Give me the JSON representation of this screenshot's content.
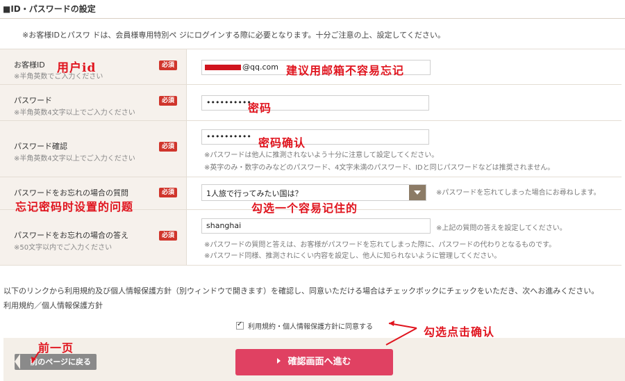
{
  "section": {
    "title": "■ID・パスワードの設定",
    "intro": "※お客様IDとパスワ ドは、会員様専用特別ペ ジにログインする際に必要となります。十分ご注意の上、設定してください。"
  },
  "fields": {
    "customer_id": {
      "label": "お客様ID",
      "sub": "※半角英数でご入力ください",
      "badge": "必須",
      "value": "@qq.com"
    },
    "password": {
      "label": "パスワード",
      "sub": "※半角英数4文字以上でご入力ください",
      "badge": "必須",
      "value": "••••••••••"
    },
    "password_confirm": {
      "label": "パスワード確認",
      "sub": "※半角英数4文字以上でご入力ください",
      "badge": "必須",
      "value": "••••••••••",
      "note1": "※パスワードは他人に推測されないよう十分に注意して設定してください。",
      "note2": "※英字のみ・数字のみなどのパスワード、4文字未満のパスワード、IDと同じパスワードなどは推奨されません。"
    },
    "question": {
      "label": "パスワードをお忘れの場合の質問",
      "badge": "必須",
      "selected": "1人旅で行ってみたい国は？",
      "note": "※パスワードを忘れてしまった場合にお尋ねします。"
    },
    "answer": {
      "label": "パスワードをお忘れの場合の答え",
      "sub": "※50文字以内でご入力ください",
      "badge": "必須",
      "value": "shanghai",
      "note": "※上記の質問の答えを設定してください。",
      "note2": "※パスワードの質問と答えは、お客様がパスワードを忘れてしまった際に、パスワードの代わりとなるものです。",
      "note3": "※パスワード同様、推測されにくい内容を設定し、他人に知られないように管理してください。"
    }
  },
  "terms": {
    "text": "以下のリンクから利用規約及び個人情報保護方針（別ウィンドウで開きます）を確認し、同意いただける場合はチェックボックにチェックをいただき、次へお進みください。",
    "link": "利用規約／個人情報保護方針",
    "agree_label": "利用規約・個人情報保護方針に同意する"
  },
  "buttons": {
    "back": "前のページに戻る",
    "confirm": "確認画面へ進む"
  },
  "annotations": {
    "user_id": "用户id",
    "email_tip": "建议用邮箱不容易忘记",
    "password": "密码",
    "password_confirm": "密码确认",
    "question": "忘记密码时设置的问题",
    "select_tip": "勾选一个容易记住的",
    "agree_tip": "勾选点击确认",
    "back_tip": "前一页"
  },
  "colors": {
    "required_badge": "#d0352c",
    "confirm_button": "#e04162",
    "annotation": "#e0141e",
    "label_bg": "#f6f1ec"
  }
}
